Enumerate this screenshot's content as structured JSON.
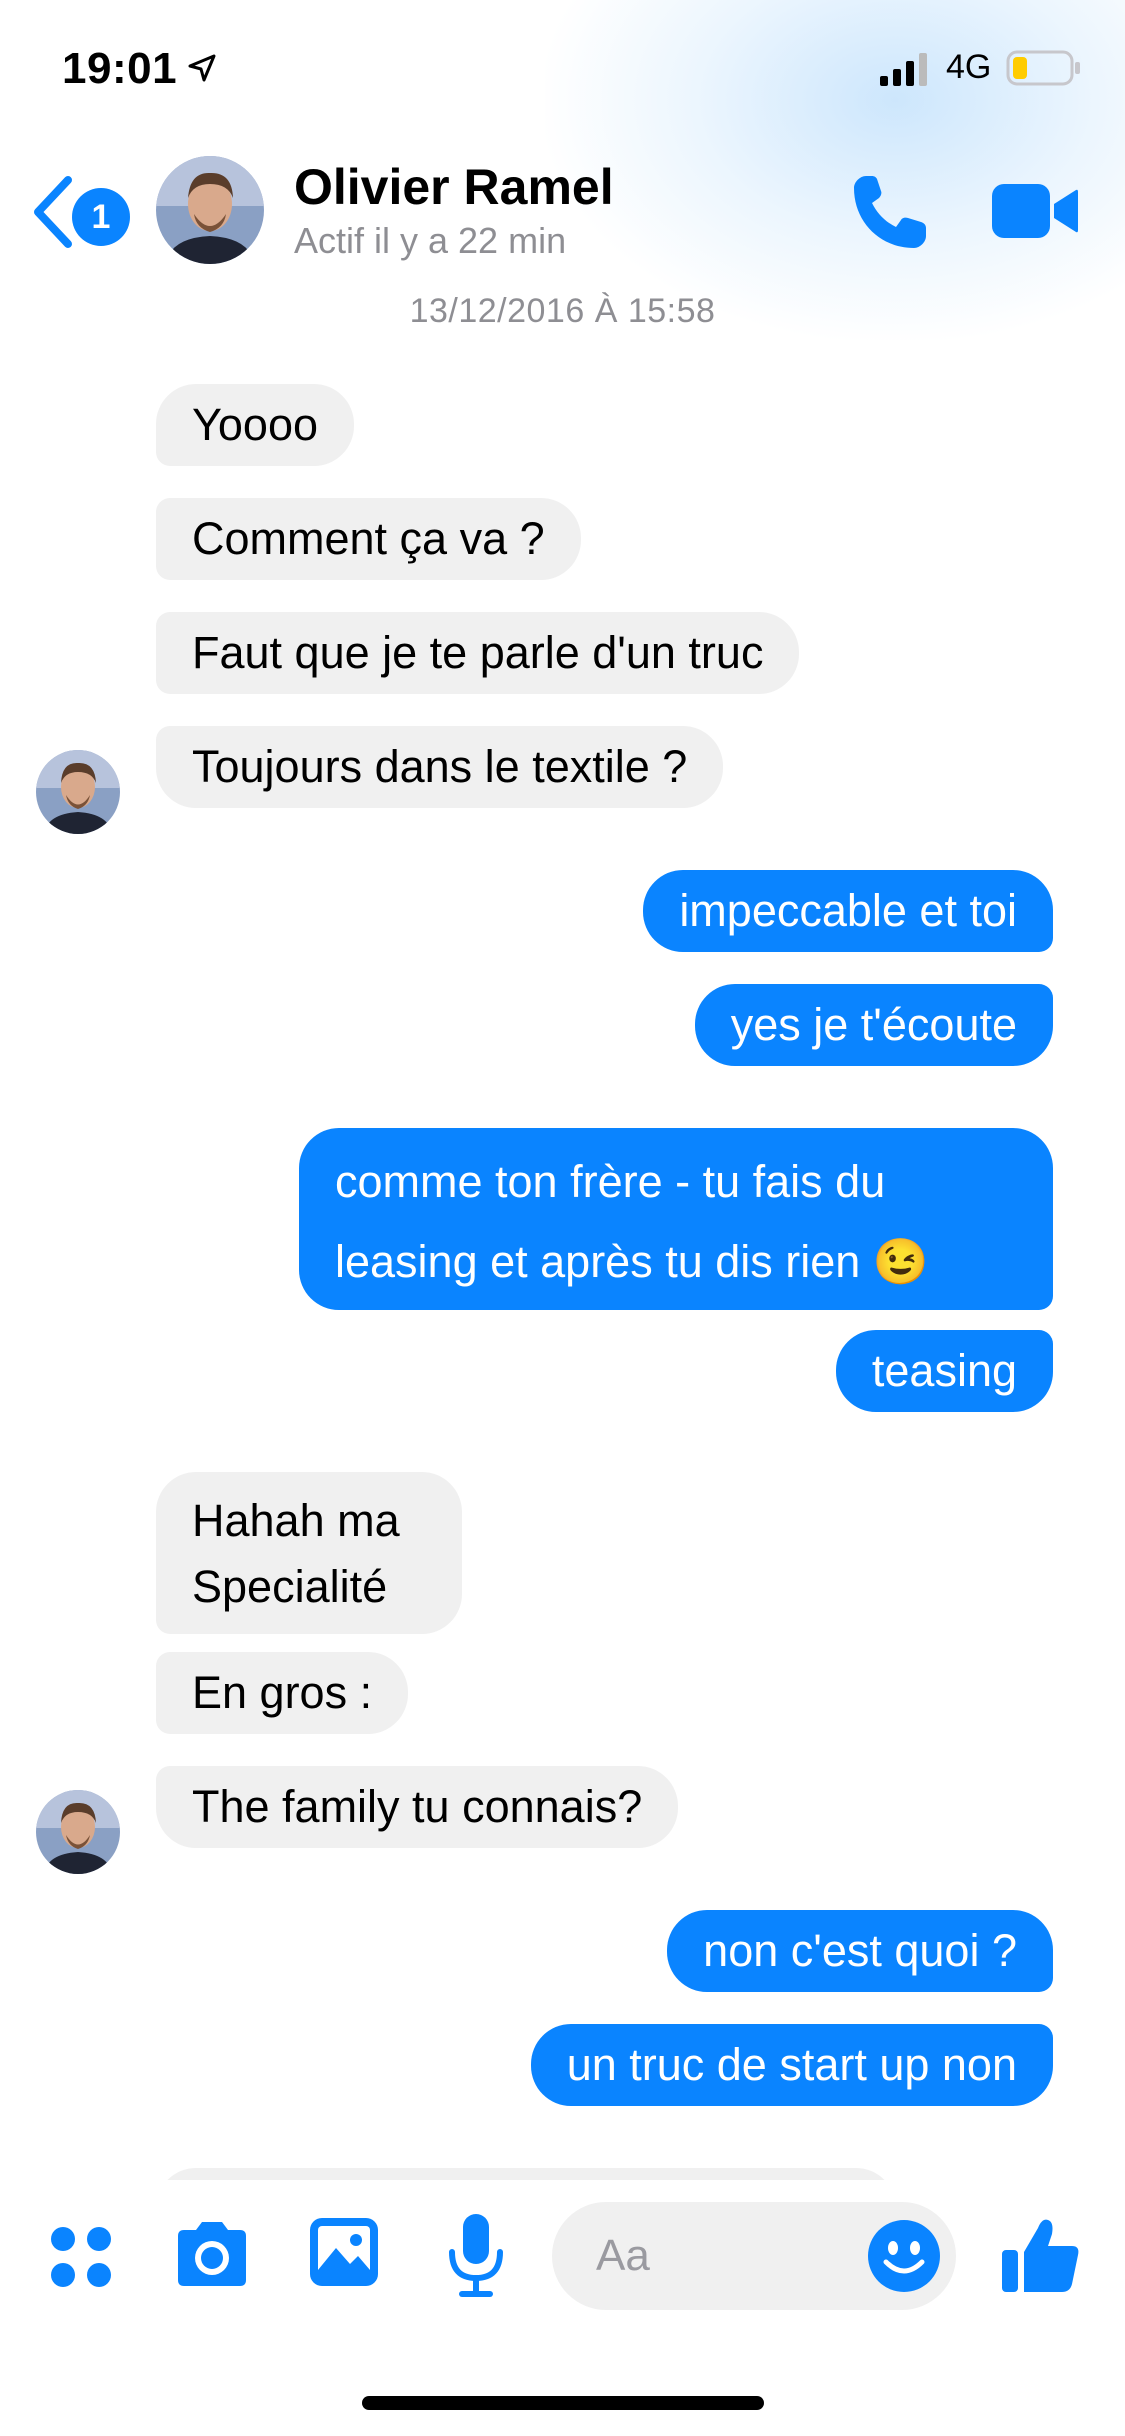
{
  "status_bar": {
    "time": "19:01",
    "network": "4G",
    "icons": [
      "location-arrow-icon",
      "cellular-signal-icon",
      "battery-low-icon"
    ]
  },
  "header": {
    "back_badge": "1",
    "contact_name": "Olivier Ramel",
    "contact_status": "Actif il y a 22 min",
    "icons": [
      "chevron-left-icon",
      "phone-icon",
      "video-camera-icon"
    ]
  },
  "conversation": {
    "timestamp": "13/12/2016 À 15:58",
    "messages": [
      {
        "side": "incoming",
        "text": "Yoooo"
      },
      {
        "side": "incoming",
        "text": "Comment ça va ?"
      },
      {
        "side": "incoming",
        "text": "Faut que je te parle d'un truc"
      },
      {
        "side": "incoming",
        "text": "Toujours dans le textile ?"
      },
      {
        "side": "outgoing",
        "text": "impeccable et toi"
      },
      {
        "side": "outgoing",
        "text": "yes je t'écoute"
      },
      {
        "side": "outgoing",
        "text": "comme ton frère - tu fais du leasing et après tu dis rien 😉"
      },
      {
        "side": "outgoing",
        "text": "teasing"
      },
      {
        "side": "incoming",
        "text": "Hahah ma Specialité"
      },
      {
        "side": "incoming",
        "text": "En gros :"
      },
      {
        "side": "incoming",
        "text": "The family tu connais?"
      },
      {
        "side": "outgoing",
        "text": "non c'est quoi ?"
      },
      {
        "side": "outgoing",
        "text": "un truc de start up non"
      }
    ]
  },
  "composer": {
    "placeholder": "Aa",
    "icons": [
      "apps-grid-icon",
      "camera-icon",
      "photo-gallery-icon",
      "microphone-icon",
      "emoji-icon",
      "thumbs-up-icon"
    ]
  },
  "colors": {
    "accent": "#0A84FF",
    "incoming_bubble": "#F0F0F0",
    "secondary_text": "#8E8E93"
  }
}
